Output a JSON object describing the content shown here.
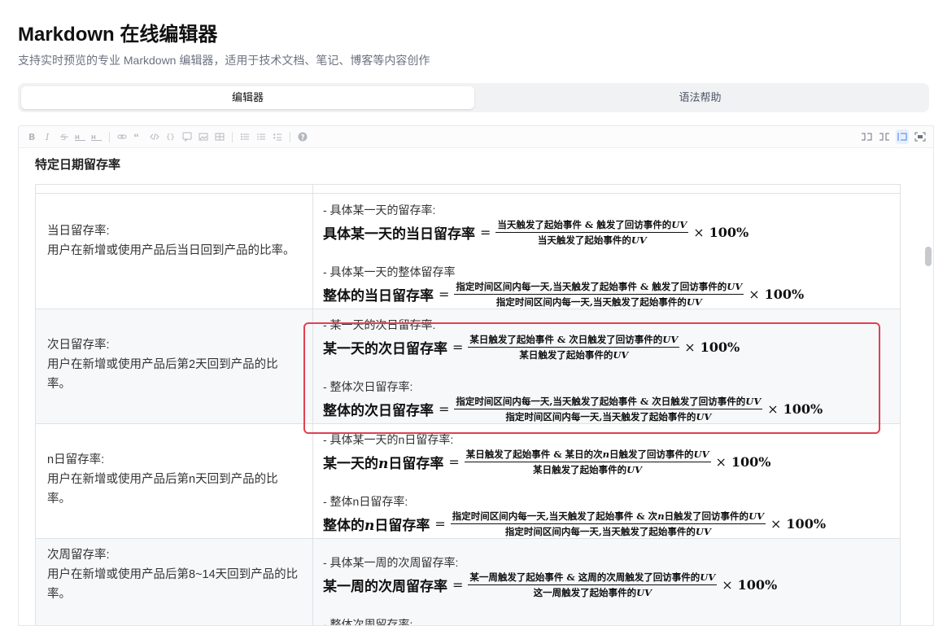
{
  "page": {
    "title": "Markdown 在线编辑器",
    "subtitle": "支持实时预览的专业 Markdown 编辑器，适用于技术文档、笔记、博客等内容创作"
  },
  "tabs": [
    {
      "label": "编辑器",
      "active": true
    },
    {
      "label": "语法帮助",
      "active": false
    }
  ],
  "toolbar": {
    "left": [
      "bold-icon",
      "italic-icon",
      "strikethrough-icon",
      "heading-icon",
      "heading-icon",
      "link-icon",
      "quote-icon",
      "code-icon",
      "code-block-icon",
      "comment-icon",
      "image-icon",
      "table-icon",
      "unordered-list-icon",
      "ordered-list-icon",
      "task-list-icon",
      "help-icon"
    ],
    "right": [
      "edit-only-icon",
      "split-view-icon",
      "preview-only-icon",
      "fullscreen-icon"
    ]
  },
  "content": {
    "section_title": "特定日期留存率",
    "rows": [
      {
        "desc_title": "当日留存率:",
        "desc_body": "用户在新增或使用产品后当日回到产品的比率。",
        "items": [
          {
            "label": "- 具体某一天的留存率:",
            "lhs": "具体某一天的当日留存率",
            "num": "当天触发了起始事件 & 触发了回访事件的",
            "den": "当天触发了起始事件的",
            "uv": "UV",
            "pct": "100%"
          },
          {
            "label": "- 具体某一天的整体留存率",
            "lhs": "整体的当日留存率",
            "num": "指定时间区间内每一天,当天触发了起始事件 & 触发了回访事件的",
            "den": "指定时间区间内每一天,当天触发了起始事件的",
            "uv": "UV",
            "pct": "100%"
          }
        ]
      },
      {
        "desc_title": "次日留存率:",
        "desc_body": "用户在新增或使用产品后第2天回到产品的比率。",
        "items": [
          {
            "label": "- 某一天的次日留存率:",
            "lhs": "某一天的次日留存率",
            "num": "某日触发了起始事件 & 次日触发了回访事件的",
            "den": "某日触发了起始事件的",
            "uv": "UV",
            "pct": "100%"
          },
          {
            "label": "- 整体次日留存率:",
            "lhs": "整体的次日留存率",
            "num": "指定时间区间内每一天,当天触发了起始事件 & 次日触发了回访事件的",
            "den": "指定时间区间内每一天,当天触发了起始事件的",
            "uv": "UV",
            "pct": "100%"
          }
        ]
      },
      {
        "desc_title": "n日留存率:",
        "desc_body": "用户在新增或使用产品后第n天回到产品的比率。",
        "items": [
          {
            "label": "- 具体某一天的n日留存率:",
            "lhs_a": "某一天的",
            "lhs_var": "n",
            "lhs_b": "日留存率",
            "num_a": "某日触发了起始事件 & 某日的次",
            "num_var": "n",
            "num_b": "日触发了回访事件的",
            "den": "某日触发了起始事件的",
            "uv": "UV",
            "pct": "100%"
          },
          {
            "label": "- 整体n日留存率:",
            "lhs_a": "整体的",
            "lhs_var": "n",
            "lhs_b": "日留存率",
            "num_a": "指定时间区间内每一天,当天触发了起始事件 & 次",
            "num_var": "n",
            "num_b": "日触发了回访事件的",
            "den": "指定时间区间内每一天,当天触发了起始事件的",
            "uv": "UV",
            "pct": "100%"
          }
        ]
      },
      {
        "desc_title": "次周留存率:",
        "desc_body": "用户在新增或使用产品后第8~14天回到产品的比率。",
        "items": [
          {
            "label": "- 具体某一周的次周留存率:",
            "lhs": "某一周的次周留存率",
            "num": "某一周触发了起始事件 & 这周的次周触发了回访事件的",
            "den": "这一周触发了起始事件的",
            "uv": "UV",
            "pct": "100%"
          },
          {
            "label": "- 整体次周留存率:"
          }
        ]
      }
    ]
  }
}
